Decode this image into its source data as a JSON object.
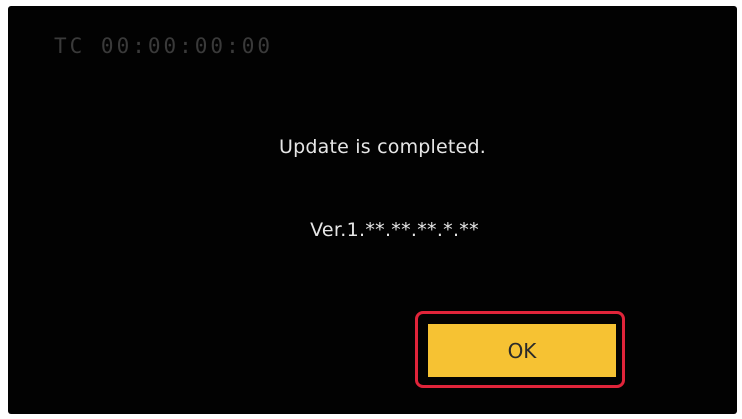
{
  "screen": {
    "timecode": "TC 00:00:00:00",
    "message": "Update is completed.",
    "version": "Ver.1.**.**.**.*.**"
  },
  "dialog": {
    "ok_label": "OK"
  },
  "colors": {
    "background": "#020202",
    "text": "#e6e6e6",
    "button": "#f6c233",
    "highlight": "#e0243a"
  }
}
